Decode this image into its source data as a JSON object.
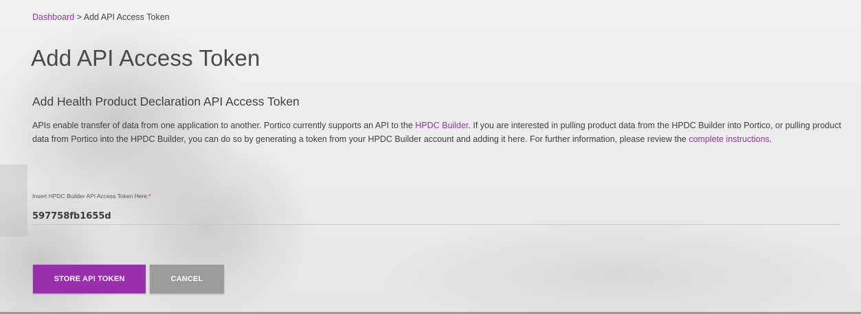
{
  "breadcrumb": {
    "link": "Dashboard",
    "separator": ">",
    "current": "Add API Access Token"
  },
  "page": {
    "title": "Add API Access Token",
    "section_title": "Add Health Product Declaration API Access Token"
  },
  "description": {
    "text_1": "APIs enable transfer of data from one application to another. Portico currently supports an API to the ",
    "link_1": "HPDC Builder",
    "text_2": ". If you are interested in pulling product data from the HPDC Builder into Portico, or pulling product data from Portico into the HPDC Builder, you can do so by generating a token from your HPDC Builder account and adding it here. For further information, please review the ",
    "link_2": "complete instructions",
    "text_3": "."
  },
  "form": {
    "label": "Insert HPDC Builder API Access Token Here:",
    "required_mark": "*",
    "token_value": "597758fb1655d"
  },
  "buttons": {
    "store": "STORE API TOKEN",
    "cancel": "CANCEL"
  },
  "colors": {
    "accent": "#9a2fae",
    "link": "#8e3a9e",
    "secondary_button": "#9b9b9b",
    "required": "#d2232a"
  }
}
